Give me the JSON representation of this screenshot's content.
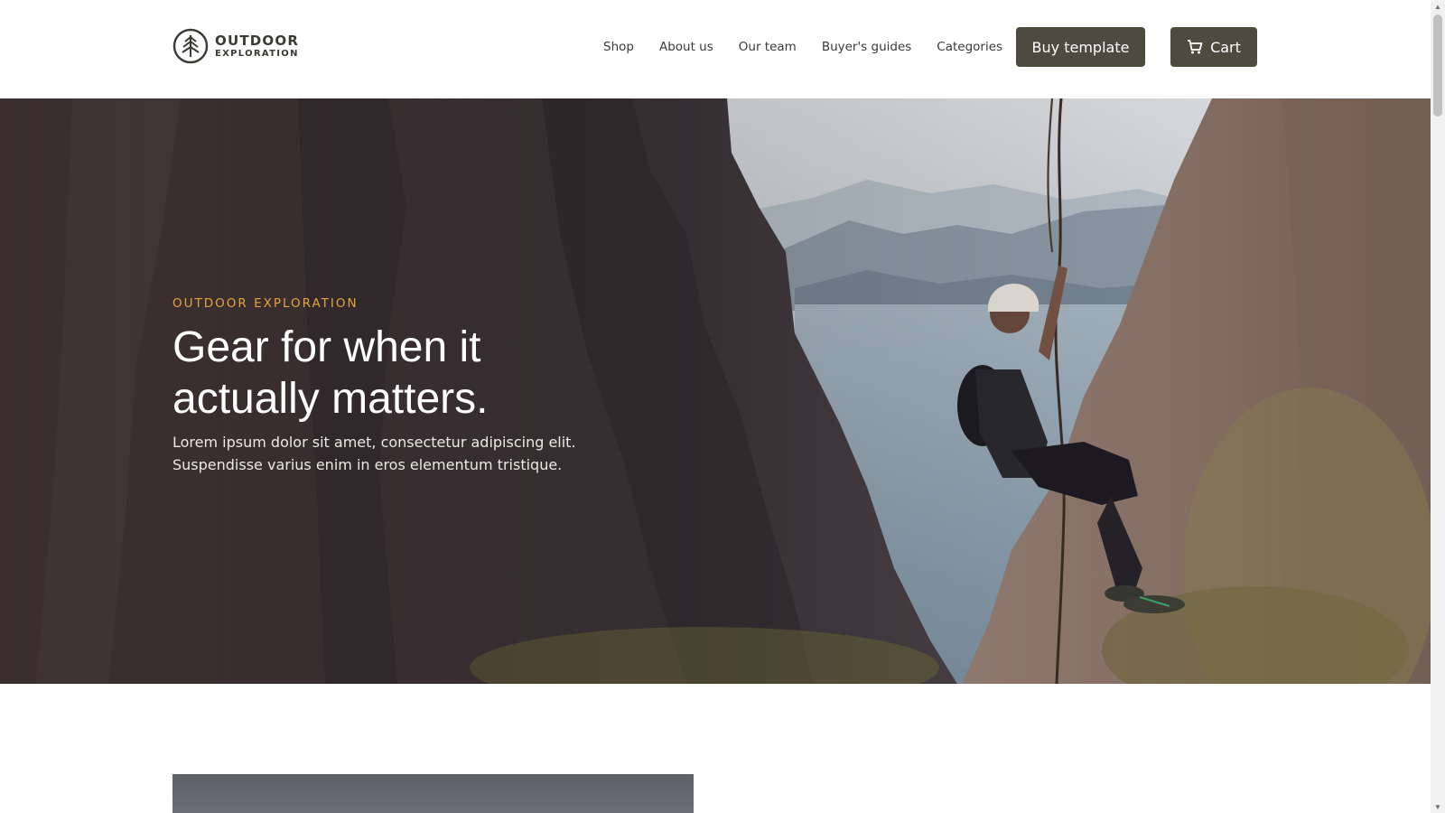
{
  "brand": {
    "name_line1": "OUTDOOR",
    "name_line2": "EXPLORATION",
    "icon": "pine-tree-logo-icon"
  },
  "nav": {
    "items": [
      {
        "label": "Shop"
      },
      {
        "label": "About us"
      },
      {
        "label": "Our team"
      },
      {
        "label": "Buyer's guides"
      },
      {
        "label": "Categories"
      }
    ],
    "buy_label": "Buy template",
    "cart_label": "Cart",
    "cart_icon": "shopping-cart-icon"
  },
  "hero": {
    "eyebrow": "OUTDOOR EXPLORATION",
    "headline_line1": "Gear for when it",
    "headline_line2": "actually matters.",
    "subtext": "Lorem ipsum dolor sit amet, consectetur adipiscing elit. Suspendisse varius enim in eros elementum tristique.",
    "image": "climber-rappelling-cliff-photo"
  },
  "colors": {
    "button": "#4d4a3f",
    "accent": "#e6a33a",
    "logo": "#3b3a34"
  }
}
